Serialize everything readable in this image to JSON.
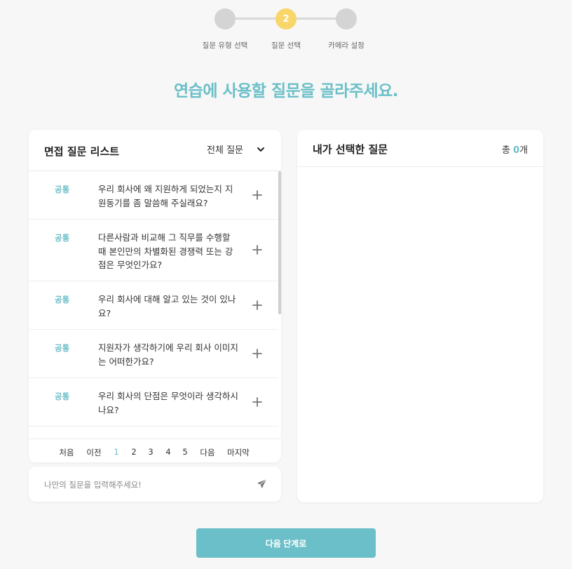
{
  "stepper": {
    "steps": [
      {
        "number": "",
        "label": "질문 유형 선택",
        "state": "inactive"
      },
      {
        "number": "2",
        "label": "질문 선택",
        "state": "active"
      },
      {
        "number": "",
        "label": "카메라 설정",
        "state": "inactive"
      }
    ],
    "active_color": "#f9d66a",
    "inactive_color": "#d4d4d4"
  },
  "heading": "연습에 사용할 질문을 골라주세요.",
  "question_list": {
    "title": "면접 질문 리스트",
    "filter_selected": "전체 질문",
    "items": [
      {
        "tag": "공통",
        "text": "우리 회사에 왜 지원하게 되었는지 지원동기를 좀 말씀해 주실래요?"
      },
      {
        "tag": "공통",
        "text": "다른사람과 비교해 그 직무를 수행할 때 본인만의 차별화된 경쟁력 또는 강점은 무엇인가요?"
      },
      {
        "tag": "공통",
        "text": "우리 회사에 대해 알고 있는 것이 있나요?"
      },
      {
        "tag": "공통",
        "text": "지원자가 생각하기에 우리 회사 이미지는 어떠한가요?"
      },
      {
        "tag": "공통",
        "text": "우리 회사의 단점은 무엇이라 생각하시나요?"
      }
    ]
  },
  "pagination": {
    "first": "처음",
    "prev": "이전",
    "pages": [
      "1",
      "2",
      "3",
      "4",
      "5"
    ],
    "current": "1",
    "next": "다음",
    "last": "마지막"
  },
  "custom_question": {
    "placeholder": "나만의 질문을 입력해주세요!"
  },
  "selected": {
    "title": "내가 선택한 질문",
    "count_prefix": "총 ",
    "count": "0",
    "count_suffix": "개"
  },
  "next_button": "다음 단계로",
  "colors": {
    "accent": "#6bbfc8",
    "background": "#f7f7f7",
    "step_active": "#f9d66a"
  }
}
